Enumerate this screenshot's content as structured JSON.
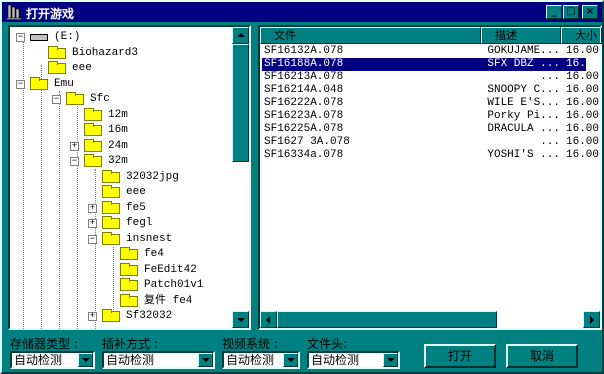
{
  "window": {
    "title": "打开游戏"
  },
  "title_buttons": {
    "min": "_",
    "max": "□",
    "close": "×"
  },
  "tree": {
    "nodes": [
      {
        "label": "(E:)",
        "kind": "drive"
      },
      {
        "label": "Biohazard3"
      },
      {
        "label": "eee"
      },
      {
        "label": "Emu"
      },
      {
        "label": "Sfc"
      },
      {
        "label": "12m"
      },
      {
        "label": "16m"
      },
      {
        "label": "24m"
      },
      {
        "label": "32m"
      },
      {
        "label": "32032jpg"
      },
      {
        "label": "eee"
      },
      {
        "label": "fe5"
      },
      {
        "label": "fegl"
      },
      {
        "label": "insnest"
      },
      {
        "label": "fe4"
      },
      {
        "label": "FeEdit42"
      },
      {
        "label": "Patch01v1"
      },
      {
        "label": "复件 fe4"
      },
      {
        "label": "Sf32032"
      }
    ]
  },
  "list": {
    "headers": [
      "文件",
      "描述",
      "大小"
    ],
    "rows": [
      {
        "file": "SF16132A.078",
        "desc": "GOKUJAME...",
        "size": "16.00"
      },
      {
        "file": "SF16188A.078",
        "desc": "SFX DBZ ...",
        "size": "16.00"
      },
      {
        "file": "SF16213A.078",
        "desc": "...",
        "size": "16.00"
      },
      {
        "file": "SF16214A.048",
        "desc": "SNOOPY C...",
        "size": "16.00"
      },
      {
        "file": "SF16222A.078",
        "desc": "WILE E'S...",
        "size": "16.00"
      },
      {
        "file": "SF16223A.078",
        "desc": "Porky Pi...",
        "size": "16.00"
      },
      {
        "file": "SF16225A.078",
        "desc": "DRACULA ...",
        "size": "16.00"
      },
      {
        "file": "SF1627 3A.078",
        "desc": "...",
        "size": "16.00"
      },
      {
        "file": "SF16334a.078",
        "desc": "YOSHI'S ...",
        "size": "16.00"
      }
    ]
  },
  "options": {
    "storage_type": {
      "label": "存储器类型 :",
      "value": "自动检测"
    },
    "interp_mode": {
      "label": "插补方式 :",
      "value": "自动检测"
    },
    "video_system": {
      "label": "视频系统 :",
      "value": "自动检测"
    },
    "file_header": {
      "label": "文件头:",
      "value": "自动检测"
    }
  },
  "buttons": {
    "open": "打开",
    "cancel": "取消"
  },
  "colors": {
    "background": "#008080",
    "titlebar": "#000080",
    "selection": "#000080",
    "folder": "#ffff00"
  }
}
